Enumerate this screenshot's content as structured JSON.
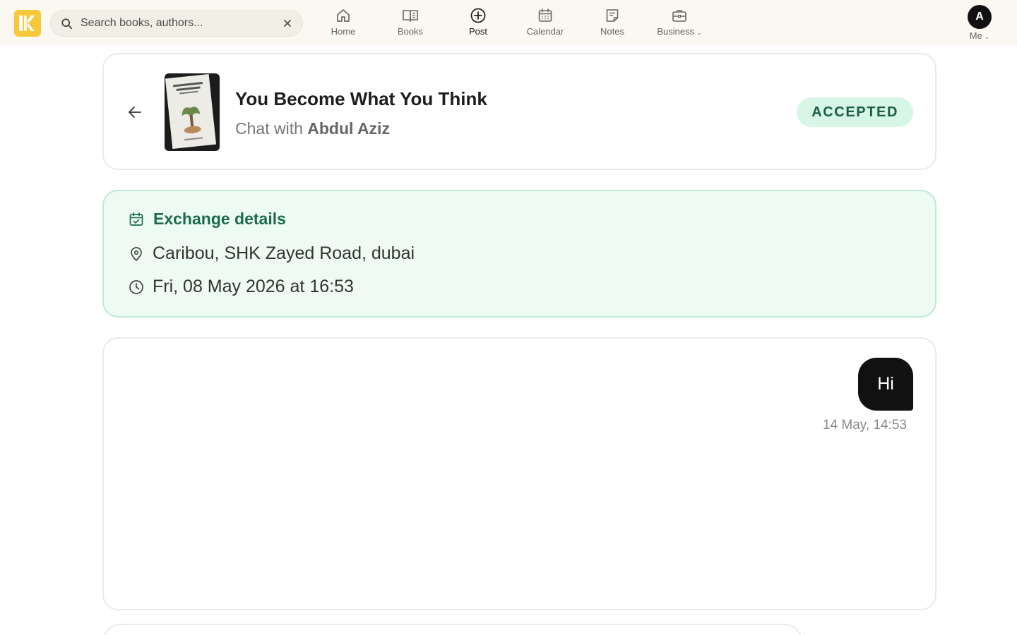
{
  "nav": {
    "search_placeholder": "Search books, authors...",
    "items": [
      {
        "label": "Home",
        "icon": "home-icon"
      },
      {
        "label": "Books",
        "icon": "book-icon"
      },
      {
        "label": "Post",
        "icon": "plus-circle-icon"
      },
      {
        "label": "Calendar",
        "icon": "calendar-icon"
      },
      {
        "label": "Notes",
        "icon": "notes-icon"
      },
      {
        "label": "Business",
        "icon": "briefcase-icon"
      }
    ],
    "me": {
      "initial": "A",
      "label": "Me"
    }
  },
  "chat_header": {
    "book_title": "You Become What You Think",
    "chat_with_prefix": "Chat with",
    "partner_name": "Abdul Aziz",
    "status": "ACCEPTED"
  },
  "exchange": {
    "title": "Exchange details",
    "location": "Caribou, SHK Zayed Road, dubai",
    "datetime": "Fri, 08 May 2026 at 16:53"
  },
  "messages": [
    {
      "text": "Hi",
      "time": "14 May, 14:53",
      "from": "me"
    }
  ],
  "colors": {
    "accent_green": "#1b6b4d",
    "badge_bg": "#d7f6e6",
    "logo_yellow": "#f7c93a",
    "bubble": "#111111"
  }
}
